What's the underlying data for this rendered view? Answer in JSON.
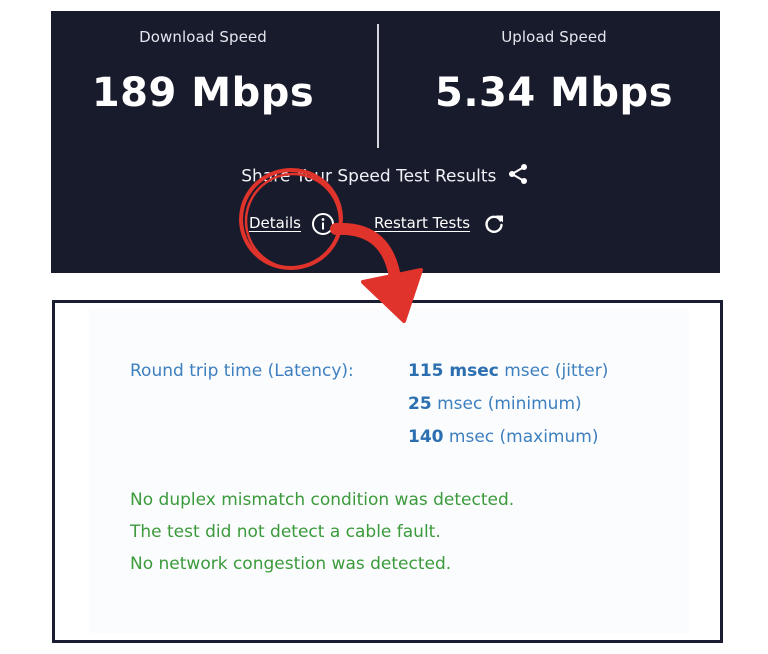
{
  "speed": {
    "download_label": "Download Speed",
    "download_value": "189 Mbps",
    "upload_label": "Upload Speed",
    "upload_value": "5.34 Mbps",
    "share_label": "Share Your Speed Test Results",
    "share_icon": "share-icon",
    "details_link": "Details",
    "details_icon": "info-icon",
    "restart_link": "Restart Tests",
    "restart_icon": "refresh-icon"
  },
  "details": {
    "latency_label": "Round trip time (Latency):",
    "latency": [
      {
        "value": "115 msec",
        "suffix": "msec (jitter)"
      },
      {
        "value": "25",
        "suffix": "msec (minimum)"
      },
      {
        "value": "140",
        "suffix": "msec (maximum)"
      }
    ],
    "diagnostics": [
      "No duplex mismatch condition was detected.",
      "The test did not detect a cable fault.",
      "No network congestion was detected."
    ]
  },
  "colors": {
    "panel_bg": "#181b2c",
    "annotation_red": "#e0332b",
    "latency_blue": "#3d7fbf",
    "diagnostic_green": "#3b9a3b"
  }
}
